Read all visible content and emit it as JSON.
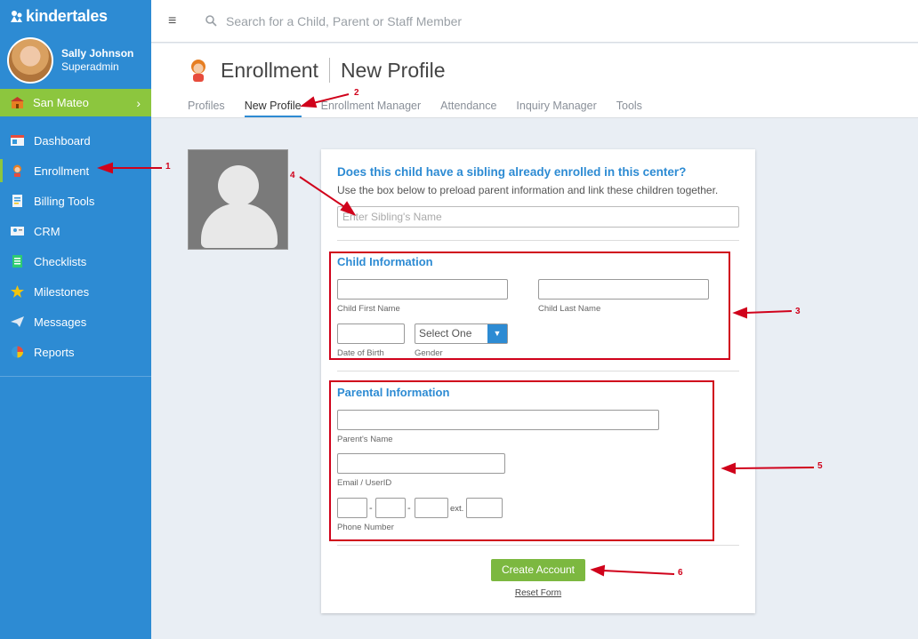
{
  "brand": {
    "name": "kindertales"
  },
  "user": {
    "name": "Sally Johnson",
    "role": "Superadmin"
  },
  "center": {
    "name": "San Mateo"
  },
  "sidebar": {
    "items": [
      {
        "label": "Dashboard",
        "icon": "dashboard-icon"
      },
      {
        "label": "Enrollment",
        "icon": "child-icon"
      },
      {
        "label": "Billing Tools",
        "icon": "billing-icon"
      },
      {
        "label": "CRM",
        "icon": "crm-icon"
      },
      {
        "label": "Checklists",
        "icon": "checklist-icon"
      },
      {
        "label": "Milestones",
        "icon": "star-icon"
      },
      {
        "label": "Messages",
        "icon": "paper-plane-icon"
      },
      {
        "label": "Reports",
        "icon": "pie-chart-icon"
      }
    ]
  },
  "search": {
    "placeholder": "Search for a Child, Parent or Staff Member"
  },
  "page": {
    "title": "Enrollment",
    "subtitle": "New Profile"
  },
  "tabs": [
    {
      "label": "Profiles"
    },
    {
      "label": "New Profile"
    },
    {
      "label": "Enrollment Manager"
    },
    {
      "label": "Attendance"
    },
    {
      "label": "Inquiry Manager"
    },
    {
      "label": "Tools"
    }
  ],
  "sibling": {
    "question": "Does this child have a sibling already enrolled in this center?",
    "description": "Use the box below to preload parent information and link these children together.",
    "placeholder": "Enter Sibling's Name"
  },
  "child_info": {
    "title": "Child Information",
    "first_name_label": "Child First Name",
    "last_name_label": "Child Last Name",
    "dob_label": "Date of Birth",
    "gender_label": "Gender",
    "gender_value": "Select One"
  },
  "parent_info": {
    "title": "Parental Information",
    "name_label": "Parent's Name",
    "email_label": "Email / UserID",
    "phone_label": "Phone Number",
    "dash": "-",
    "ext_label": "ext."
  },
  "actions": {
    "create": "Create Account",
    "reset": "Reset Form"
  },
  "annotations": {
    "n1": "1",
    "n2": "2",
    "n3": "3",
    "n4": "4",
    "n5": "5",
    "n6": "6"
  },
  "colors": {
    "primary": "#2d8bd3",
    "accent": "#8cc63e",
    "annotation": "#d0021b"
  }
}
